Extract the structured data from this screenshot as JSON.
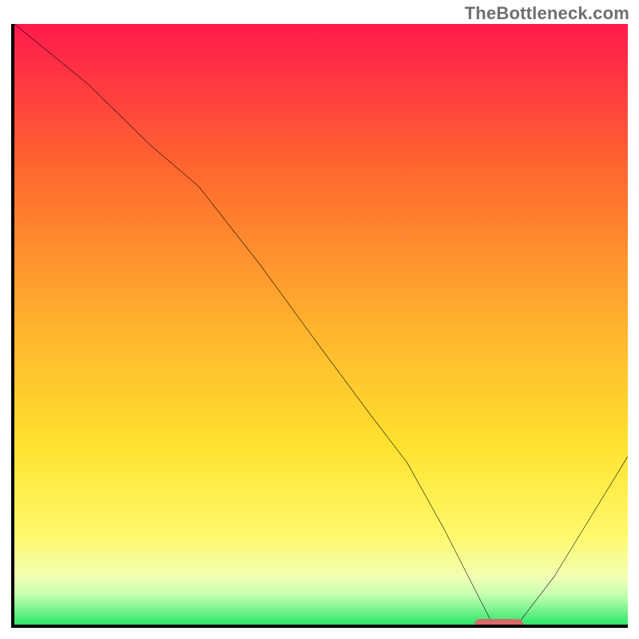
{
  "watermark": {
    "text": "TheBottleneck.com"
  },
  "chart_data": {
    "type": "line",
    "title": "",
    "xlabel": "",
    "ylabel": "",
    "xlim": [
      0,
      100
    ],
    "ylim": [
      0,
      100
    ],
    "x": [
      0,
      12,
      22,
      30,
      40,
      50,
      58,
      64,
      70,
      75,
      78,
      82,
      88,
      94,
      100
    ],
    "values": [
      100,
      90,
      80,
      73,
      60,
      46,
      35,
      27,
      16,
      6,
      0,
      0,
      8,
      18,
      28
    ],
    "marker": {
      "x_start": 75,
      "x_end": 83,
      "y": 0,
      "color": "#d46a6a"
    },
    "gradient_stops": [
      {
        "offset": 0.0,
        "color": "#ff1a4d"
      },
      {
        "offset": 0.25,
        "color": "#ff6a2e"
      },
      {
        "offset": 0.5,
        "color": "#ffb22e"
      },
      {
        "offset": 0.7,
        "color": "#ffe22e"
      },
      {
        "offset": 0.85,
        "color": "#fff96a"
      },
      {
        "offset": 0.92,
        "color": "#f2ffb3"
      },
      {
        "offset": 0.95,
        "color": "#c7ffb3"
      },
      {
        "offset": 1.0,
        "color": "#2ee66a"
      }
    ]
  }
}
